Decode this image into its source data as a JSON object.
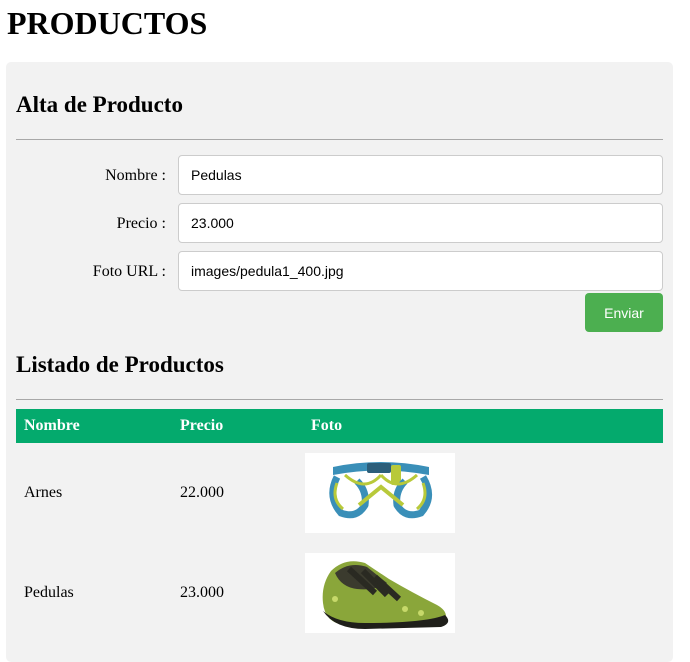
{
  "page": {
    "title": "PRODUCTOS"
  },
  "form": {
    "title": "Alta de Producto",
    "fields": [
      {
        "label": "Nombre :",
        "value": "Pedulas"
      },
      {
        "label": "Precio :",
        "value": "23.000"
      },
      {
        "label": "Foto URL :",
        "value": "images/pedula1_400.jpg"
      }
    ],
    "submit_label": "Enviar"
  },
  "list": {
    "title": "Listado de Productos",
    "headers": [
      "Nombre",
      "Precio",
      "Foto"
    ],
    "rows": [
      {
        "name": "Arnes",
        "price": "22.000",
        "photo": "harness-image"
      },
      {
        "name": "Pedulas",
        "price": "23.000",
        "photo": "climbing-shoe-image"
      }
    ]
  },
  "colors": {
    "header_green": "#04aa6d",
    "button_green": "#4caf50",
    "panel_bg": "#f2f2f2"
  }
}
